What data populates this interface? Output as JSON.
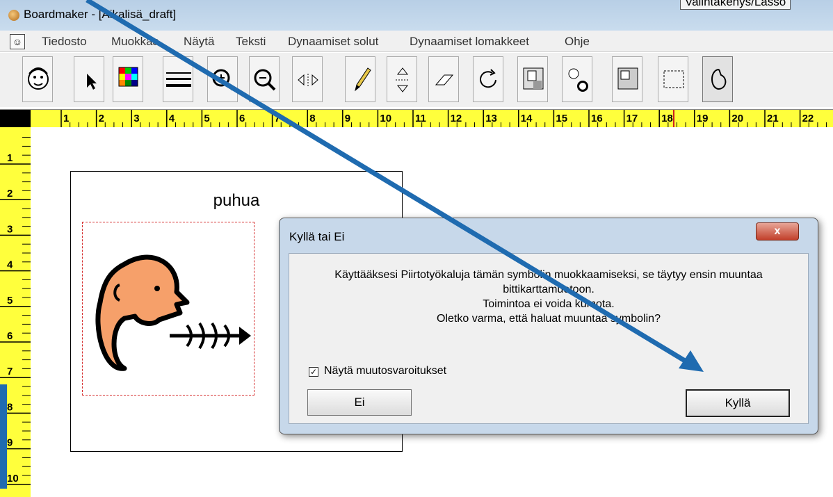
{
  "window": {
    "title": "Boardmaker - [Aikalisä_draft]",
    "tooltip": "Valintakehys/Lasso"
  },
  "menu": {
    "items": [
      "Tiedosto",
      "Muokkaa",
      "Näytä",
      "Teksti",
      "Dynaamiset solut",
      "Dynaamiset lomakkeet",
      "Ohje"
    ]
  },
  "toolbar": {
    "tools": [
      "symbol-finder",
      "pointer",
      "color",
      "line-thickness",
      "zoom-in",
      "zoom-out",
      "horizontal-flip",
      "pencil",
      "vertical-flip",
      "eraser",
      "rotate",
      "fill",
      "symbol-faces",
      "color-fill",
      "selection-lasso",
      "freeform"
    ]
  },
  "rulers": {
    "horizontal": [
      "1",
      "2",
      "3",
      "4",
      "5",
      "6",
      "7",
      "8",
      "9",
      "10",
      "11",
      "12",
      "13",
      "14",
      "15",
      "16",
      "17",
      "18",
      "19",
      "20",
      "21",
      "22",
      "2"
    ],
    "vertical": [
      "1",
      "2",
      "3",
      "4",
      "5",
      "6",
      "7",
      "8",
      "9",
      "10"
    ]
  },
  "card": {
    "label": "puhua"
  },
  "dialog": {
    "title": "Kyllä tai Ei",
    "close": "x",
    "message": [
      "Käyttääksesi Piirtotyökaluja tämän symbolin muokkaamiseksi, se täytyy ensin muuntaa",
      "bittikarttamuotoon.",
      "Toimintoa ei voida kumota.",
      "Oletko varma, että haluat muuntaa symbolin?"
    ],
    "checkbox": {
      "label": "Näytä muutosvaroitukset",
      "checked": true,
      "mark": "✓"
    },
    "buttons": {
      "no": "Ei",
      "yes": "Kyllä"
    }
  },
  "colors": {
    "ruler": "#ffff3c",
    "annotation": "#1f6bb0",
    "dialog_frame": "#c7d8ea"
  }
}
